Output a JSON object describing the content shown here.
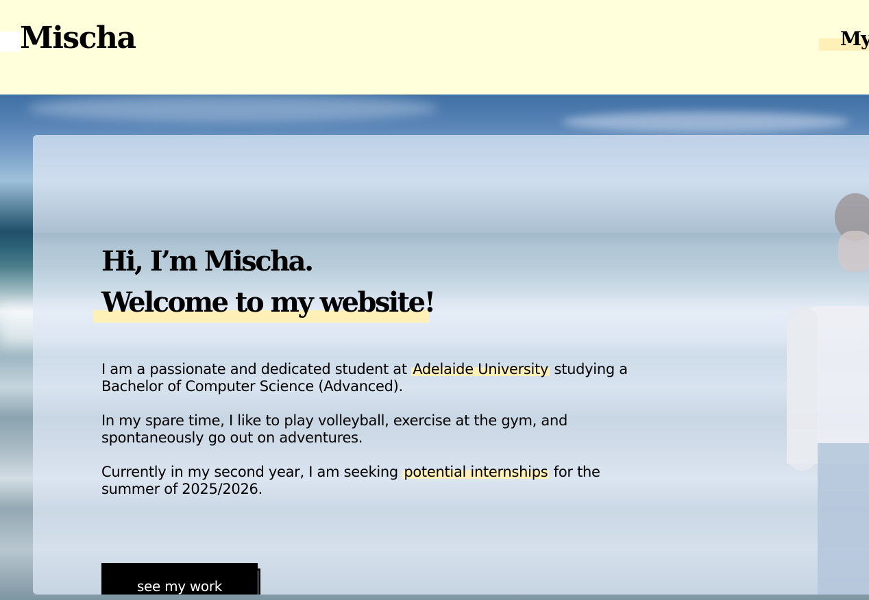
{
  "header": {
    "logo": "Mischa",
    "nav_item": "My"
  },
  "hero": {
    "greeting_line1": "Hi, I’m Mischa.",
    "greeting_line2": "Welcome to my website!",
    "paragraph1_a": "I am a passionate and dedicated student at",
    "paragraph1_highlight": "Adelaide University",
    "paragraph1_b": "studying a Bachelor of Computer Science (Advanced).",
    "paragraph2": "In my spare time, I like to play volleyball, exercise at the gym, and spontaneously go out on adventures.",
    "paragraph3_a": "Currently in my second year, I am seeking",
    "paragraph3_highlight": "potential internships",
    "paragraph3_b": "for the summer of 2025/2026.",
    "cta_label": "see my work"
  },
  "colors": {
    "header_bg": "#ffffdc",
    "highlight": "#fff0b8",
    "button_bg": "#000000",
    "button_text": "#ffffff"
  }
}
